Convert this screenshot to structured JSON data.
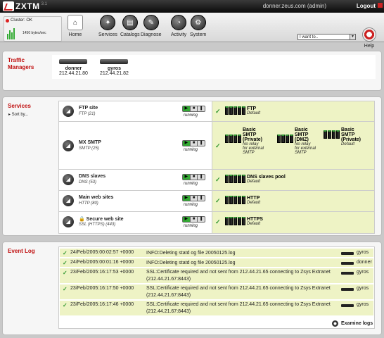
{
  "header": {
    "app_name": "ZXTM",
    "version": "3.1",
    "host_user": "donner.zeus.com (admin)",
    "logout_label": "Logout"
  },
  "cluster": {
    "status": "Cluster: OK",
    "rate": "1450 bytes/sec"
  },
  "toolbar": {
    "home": "Home",
    "services": "Services",
    "catalogs": "Catalogs",
    "diagnose": "Diagnose",
    "activity": "Activity",
    "system": "System",
    "ask_value": "I want to..",
    "help": "Help"
  },
  "traffic_managers": {
    "title": "Traffic Managers",
    "items": [
      {
        "name": "donner",
        "ip": "212.44.21.80"
      },
      {
        "name": "gyros",
        "ip": "212.44.21.82"
      }
    ]
  },
  "services": {
    "title": "Services",
    "sort_label": "▸ Sort by...",
    "rows": [
      {
        "name": "FTP site",
        "sub": "FTP (21)",
        "state": "running",
        "pools": [
          {
            "name": "FTP",
            "desc": "Default"
          }
        ]
      },
      {
        "name": "MX SMTP",
        "sub": "SMTP (25)",
        "state": "running",
        "pools": [
          {
            "name": "Basic SMTP (Private)",
            "desc": "No relay for external SMTP"
          },
          {
            "name": "Basic SMTP (DMZ)",
            "desc": "No relay for external SMTP"
          },
          {
            "name": "Basic SMTP (Private)",
            "desc": "Default"
          }
        ]
      },
      {
        "name": "DNS slaves",
        "sub": "DNS (53)",
        "state": "running",
        "pools": [
          {
            "name": "DNS slaves pool",
            "desc": "Default"
          }
        ]
      },
      {
        "name": "Main web sites",
        "sub": "HTTP (80)",
        "state": "running",
        "pools": [
          {
            "name": "HTTP",
            "desc": "Default"
          }
        ]
      },
      {
        "name": "🔒 Secure web site",
        "sub": "SSL (HTTPS) (443)",
        "state": "running",
        "pools": [
          {
            "name": "HTTPS",
            "desc": "Default"
          }
        ]
      }
    ]
  },
  "event_log": {
    "title": "Event Log",
    "entries": [
      {
        "time": "24/Feb/2005:00:02:57 +0000",
        "message": "INFO:Deleting statd og file 20050125.log",
        "host": "gyros"
      },
      {
        "time": "24/Feb/2005:00:01:16 +0000",
        "message": "INFO:Deleting statd og file 20050125.log",
        "host": "donner"
      },
      {
        "time": "23/Feb/2005:16:17:53 +0000",
        "message": "SSL:Certificate required and not sent from 212.44.21.65 connecting to Zsys Extranet (212.44.21.67:8443)",
        "host": "gyros"
      },
      {
        "time": "23/Feb/2005:16:17:50 +0000",
        "message": "SSL:Certificate required and not sent from 212.44.21.65 connecting to Zsys Extranet (212.44.21.67:8443)",
        "host": "gyros"
      },
      {
        "time": "23/Feb/2005:16:17:46 +0000",
        "message": "SSL:Certificate required and not sent from 212.44.21.65 connecting to Zsys Extranet (212.44.21.67:8443)",
        "host": "gyros"
      }
    ],
    "examine_label": "Examine logs"
  }
}
